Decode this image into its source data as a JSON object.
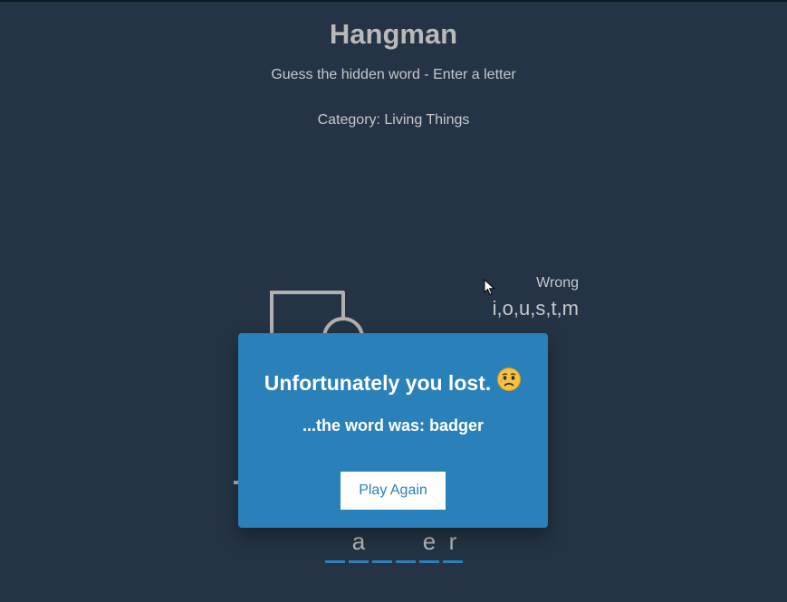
{
  "header": {
    "title": "Hangman",
    "subtitle": "Guess the hidden word - Enter a letter",
    "category": "Category: Living Things"
  },
  "wrong": {
    "label": "Wrong",
    "letters": "i,o,u,s,t,m"
  },
  "word": {
    "slots": [
      "",
      "a",
      "",
      "",
      "e",
      "r"
    ]
  },
  "popup": {
    "message": "Unfortunately you lost.",
    "emoji": "sad-face-with-sweat-emoji",
    "reveal": "...the word was: badger",
    "button_label": "Play Again"
  },
  "colors": {
    "background": "#243444",
    "popup": "#2a80b9",
    "text": "#c8c8c8",
    "button_bg": "#ffffff",
    "button_text": "#2a80b9"
  }
}
